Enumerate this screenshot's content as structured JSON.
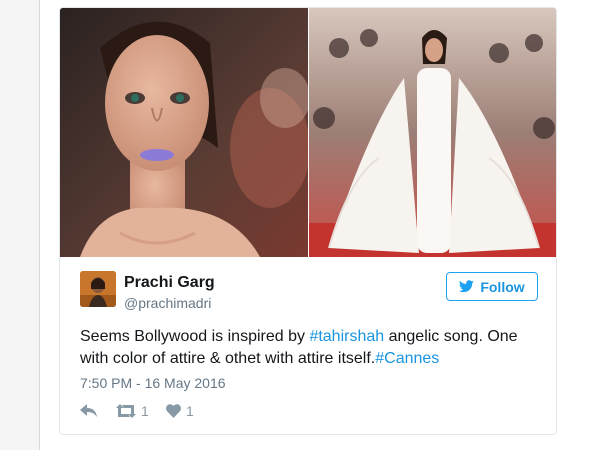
{
  "tweet": {
    "author_name": "Prachi Garg",
    "author_handle": "@prachimadri",
    "follow_label": "Follow",
    "text_prefix": "Seems Bollywood is inspired by ",
    "hashtag_1": "#tahirshah",
    "text_middle": " angelic song. One with color of attire & othet with attire itself.",
    "hashtag_2": "#Cannes",
    "timestamp": "7:50 PM - 16 May 2016",
    "retweet_count": "1",
    "like_count": "1"
  },
  "colors": {
    "accent": "#1da1f2",
    "link": "#1b95e0",
    "text": "#14171a",
    "muted": "#657786"
  },
  "icons": {
    "follow": "twitter-bird-icon",
    "reply": "reply-icon",
    "retweet": "retweet-icon",
    "like": "heart-icon"
  }
}
